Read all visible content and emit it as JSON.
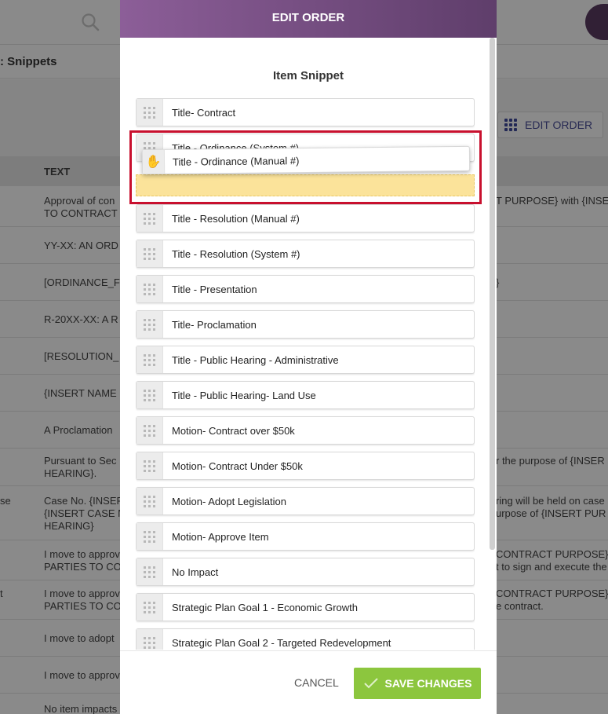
{
  "page": {
    "subheader_title": ": Snippets",
    "toolbar_edit_order": "EDIT ORDER",
    "column_text": "TEXT"
  },
  "rows": [
    {
      "left": "Approval of con\nTO CONTRACT",
      "right": "T PURPOSE} with {INSE",
      "edge": ""
    },
    {
      "left": "YY-XX: AN ORD",
      "right": "",
      "edge": ""
    },
    {
      "left": "[ORDINANCE_F",
      "right": "}",
      "edge": ""
    },
    {
      "left": "R-20XX-XX: A R",
      "right": "",
      "edge": ""
    },
    {
      "left": "[RESOLUTION_",
      "right": "",
      "edge": ""
    },
    {
      "left": "{INSERT NAME",
      "right": "",
      "edge": ""
    },
    {
      "left": "A Proclamation",
      "right": "",
      "edge": ""
    },
    {
      "left": "Pursuant to Sec\nHEARING}.",
      "right": "r the purpose of {INSER",
      "edge": ""
    },
    {
      "left": "Case No. {INSER\n{INSERT CASE N\nHEARING}",
      "right": "ring will be held on case\nurpose of {INSERT PUR",
      "edge": "se"
    },
    {
      "left": "I move to approv\nPARTIES TO CO",
      "right": "CONTRACT PURPOSE} v\nt to sign and execute the",
      "edge": ""
    },
    {
      "left": "I move to approv\nPARTIES TO CO",
      "right": "CONTRACT PURPOSE} v\ne contract.",
      "edge": "t"
    },
    {
      "left": "I move to adopt",
      "right": "",
      "edge": ""
    },
    {
      "left": "I move to approv",
      "right": "",
      "edge": ""
    },
    {
      "left": "No item impacts",
      "right": "",
      "edge": ""
    }
  ],
  "modal": {
    "title": "EDIT ORDER",
    "subtitle": "Item Snippet",
    "items": [
      "Title- Contract",
      "Title - Ordinance (System #)",
      "Title - Resolution (Manual #)",
      "Title - Resolution (System #)",
      "Title - Presentation",
      "Title- Proclamation",
      "Title - Public Hearing - Administrative",
      "Title - Public Hearing- Land Use",
      "Motion- Contract over $50k",
      "Motion- Contract Under $50k",
      "Motion- Adopt Legislation",
      "Motion- Approve Item",
      "No Impact",
      "Strategic Plan Goal 1 - Economic Growth",
      "Strategic Plan Goal 2 - Targeted Redevelopment"
    ],
    "dragging_item": "Title - Ordinance (Manual #)",
    "cancel": "CANCEL",
    "save": "SAVE CHANGES"
  },
  "colors": {
    "header_start": "#8c5e98",
    "header_end": "#5f3e6b",
    "save": "#8cc63e",
    "highlight": "#c8102e",
    "placeholder": "#fbe39a"
  },
  "icons": {
    "search": "search-icon",
    "drag_handle": "drag-handle-icon",
    "grab_cursor": "grab-hand-icon",
    "check": "check-icon",
    "grid": "grid-icon"
  }
}
